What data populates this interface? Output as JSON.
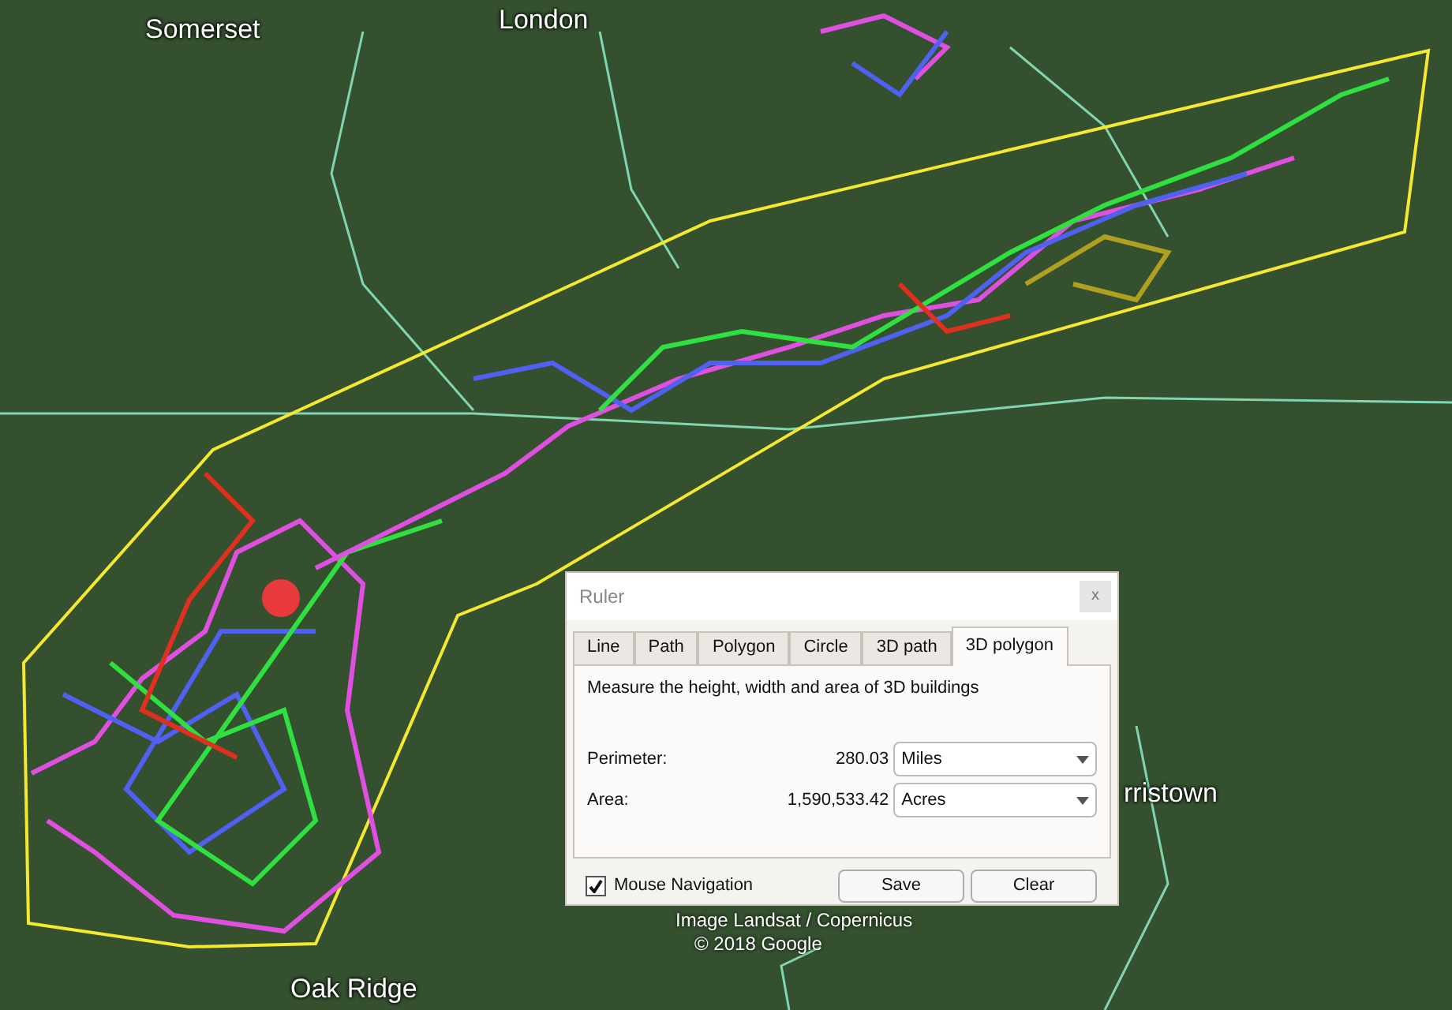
{
  "map": {
    "labels": [
      {
        "text": "Somerset"
      },
      {
        "text": "London"
      },
      {
        "text": "rristown"
      },
      {
        "text": "Oak Ridge"
      }
    ],
    "attribution": [
      "Image Landsat / Copernicus",
      "© 2018 Google"
    ]
  },
  "dialog": {
    "title": "Ruler",
    "close": "x",
    "tabs": [
      {
        "label": "Line",
        "selected": false
      },
      {
        "label": "Path",
        "selected": false
      },
      {
        "label": "Polygon",
        "selected": false
      },
      {
        "label": "Circle",
        "selected": false
      },
      {
        "label": "3D path",
        "selected": false
      },
      {
        "label": "3D polygon",
        "selected": true
      }
    ],
    "description": "Measure the height, width and area of 3D buildings",
    "measurements": [
      {
        "label": "Perimeter:",
        "value": "280.03",
        "unit": "Miles"
      },
      {
        "label": "Area:",
        "value": "1,590,533.42",
        "unit": "Acres"
      }
    ],
    "mouse_navigation": {
      "label": "Mouse Navigation",
      "checked": true
    },
    "buttons": [
      "Save",
      "Clear"
    ]
  }
}
